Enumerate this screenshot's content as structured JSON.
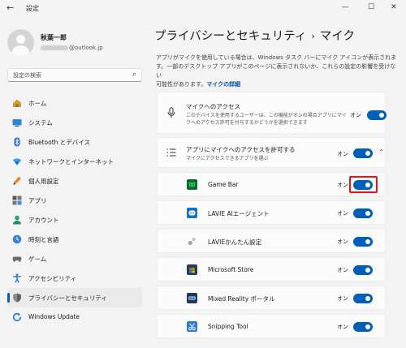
{
  "window": {
    "title": "設定",
    "back": "←",
    "minimize": "—",
    "maximize": "☐",
    "close": "✕"
  },
  "user": {
    "name": "秋葉一郎",
    "email_suffix": "@outlook.jp"
  },
  "search": {
    "placeholder": "設定の検索",
    "icon": "search-icon"
  },
  "sidebar": {
    "items": [
      {
        "label": "ホーム",
        "icon": "home-icon"
      },
      {
        "label": "システム",
        "icon": "system-icon"
      },
      {
        "label": "Bluetooth とデバイス",
        "icon": "bluetooth-icon"
      },
      {
        "label": "ネットワークとインターネット",
        "icon": "network-icon"
      },
      {
        "label": "個人用設定",
        "icon": "personalization-icon"
      },
      {
        "label": "アプリ",
        "icon": "apps-icon"
      },
      {
        "label": "アカウント",
        "icon": "accounts-icon"
      },
      {
        "label": "時刻と言語",
        "icon": "time-language-icon"
      },
      {
        "label": "ゲーム",
        "icon": "gaming-icon"
      },
      {
        "label": "アクセシビリティ",
        "icon": "accessibility-icon"
      },
      {
        "label": "プライバシーとセキュリティ",
        "icon": "privacy-shield-icon",
        "selected": true
      },
      {
        "label": "Windows Update",
        "icon": "windows-update-icon"
      }
    ]
  },
  "breadcrumb": {
    "parent": "プライバシーとセキュリティ",
    "separator": "›",
    "current": "マイク"
  },
  "description": {
    "line1": "アプリがマイクを使用している場合は、Windows タスク バーにマイク アイコンが表示されま",
    "line2": "す。一部のデスクトップ アプリがこのページに表示されないか、これらの設定の影響を受けない",
    "line3": "可能性があります。",
    "link": "マイクの詳細"
  },
  "mic_access": {
    "title": "マイクへのアクセス",
    "sub1": "このデバイスを使用するユーザーは、この機能がオンの場合アプリにマイ",
    "sub2": "クへのアクセス許可を付与するかどうかを選択できます",
    "state": "オン",
    "on": true
  },
  "app_access": {
    "title": "アプリにマイクへのアクセスを許可する",
    "sub": "マイクにアクセスできるアプリを選ぶ",
    "state": "オン",
    "on": true,
    "expand_icon": "chevron-up-icon"
  },
  "apps": [
    {
      "name": "Game Bar",
      "state": "オン",
      "on": true,
      "color": "#0b6b2c",
      "highlighted": true
    },
    {
      "name": "LAVIE AIエージェント",
      "state": "オン",
      "on": true,
      "color": "#1671c4"
    },
    {
      "name": "LAVIEかんたん設定",
      "state": "オン",
      "on": true,
      "color": "#9a9a9a"
    },
    {
      "name": "Microsoft Store",
      "state": "オン",
      "on": true,
      "color": "#243a5e"
    },
    {
      "name": "Mixed Reality ポータル",
      "state": "オン",
      "on": true,
      "color": "#26364f"
    },
    {
      "name": "Snipping Tool",
      "state": "オン",
      "on": true,
      "color": "#2b7bd4"
    }
  ],
  "colors": {
    "accent": "#005fb8",
    "highlight": "#e0161a",
    "background": "#f3f3f3",
    "card": "#fbfbfb"
  }
}
